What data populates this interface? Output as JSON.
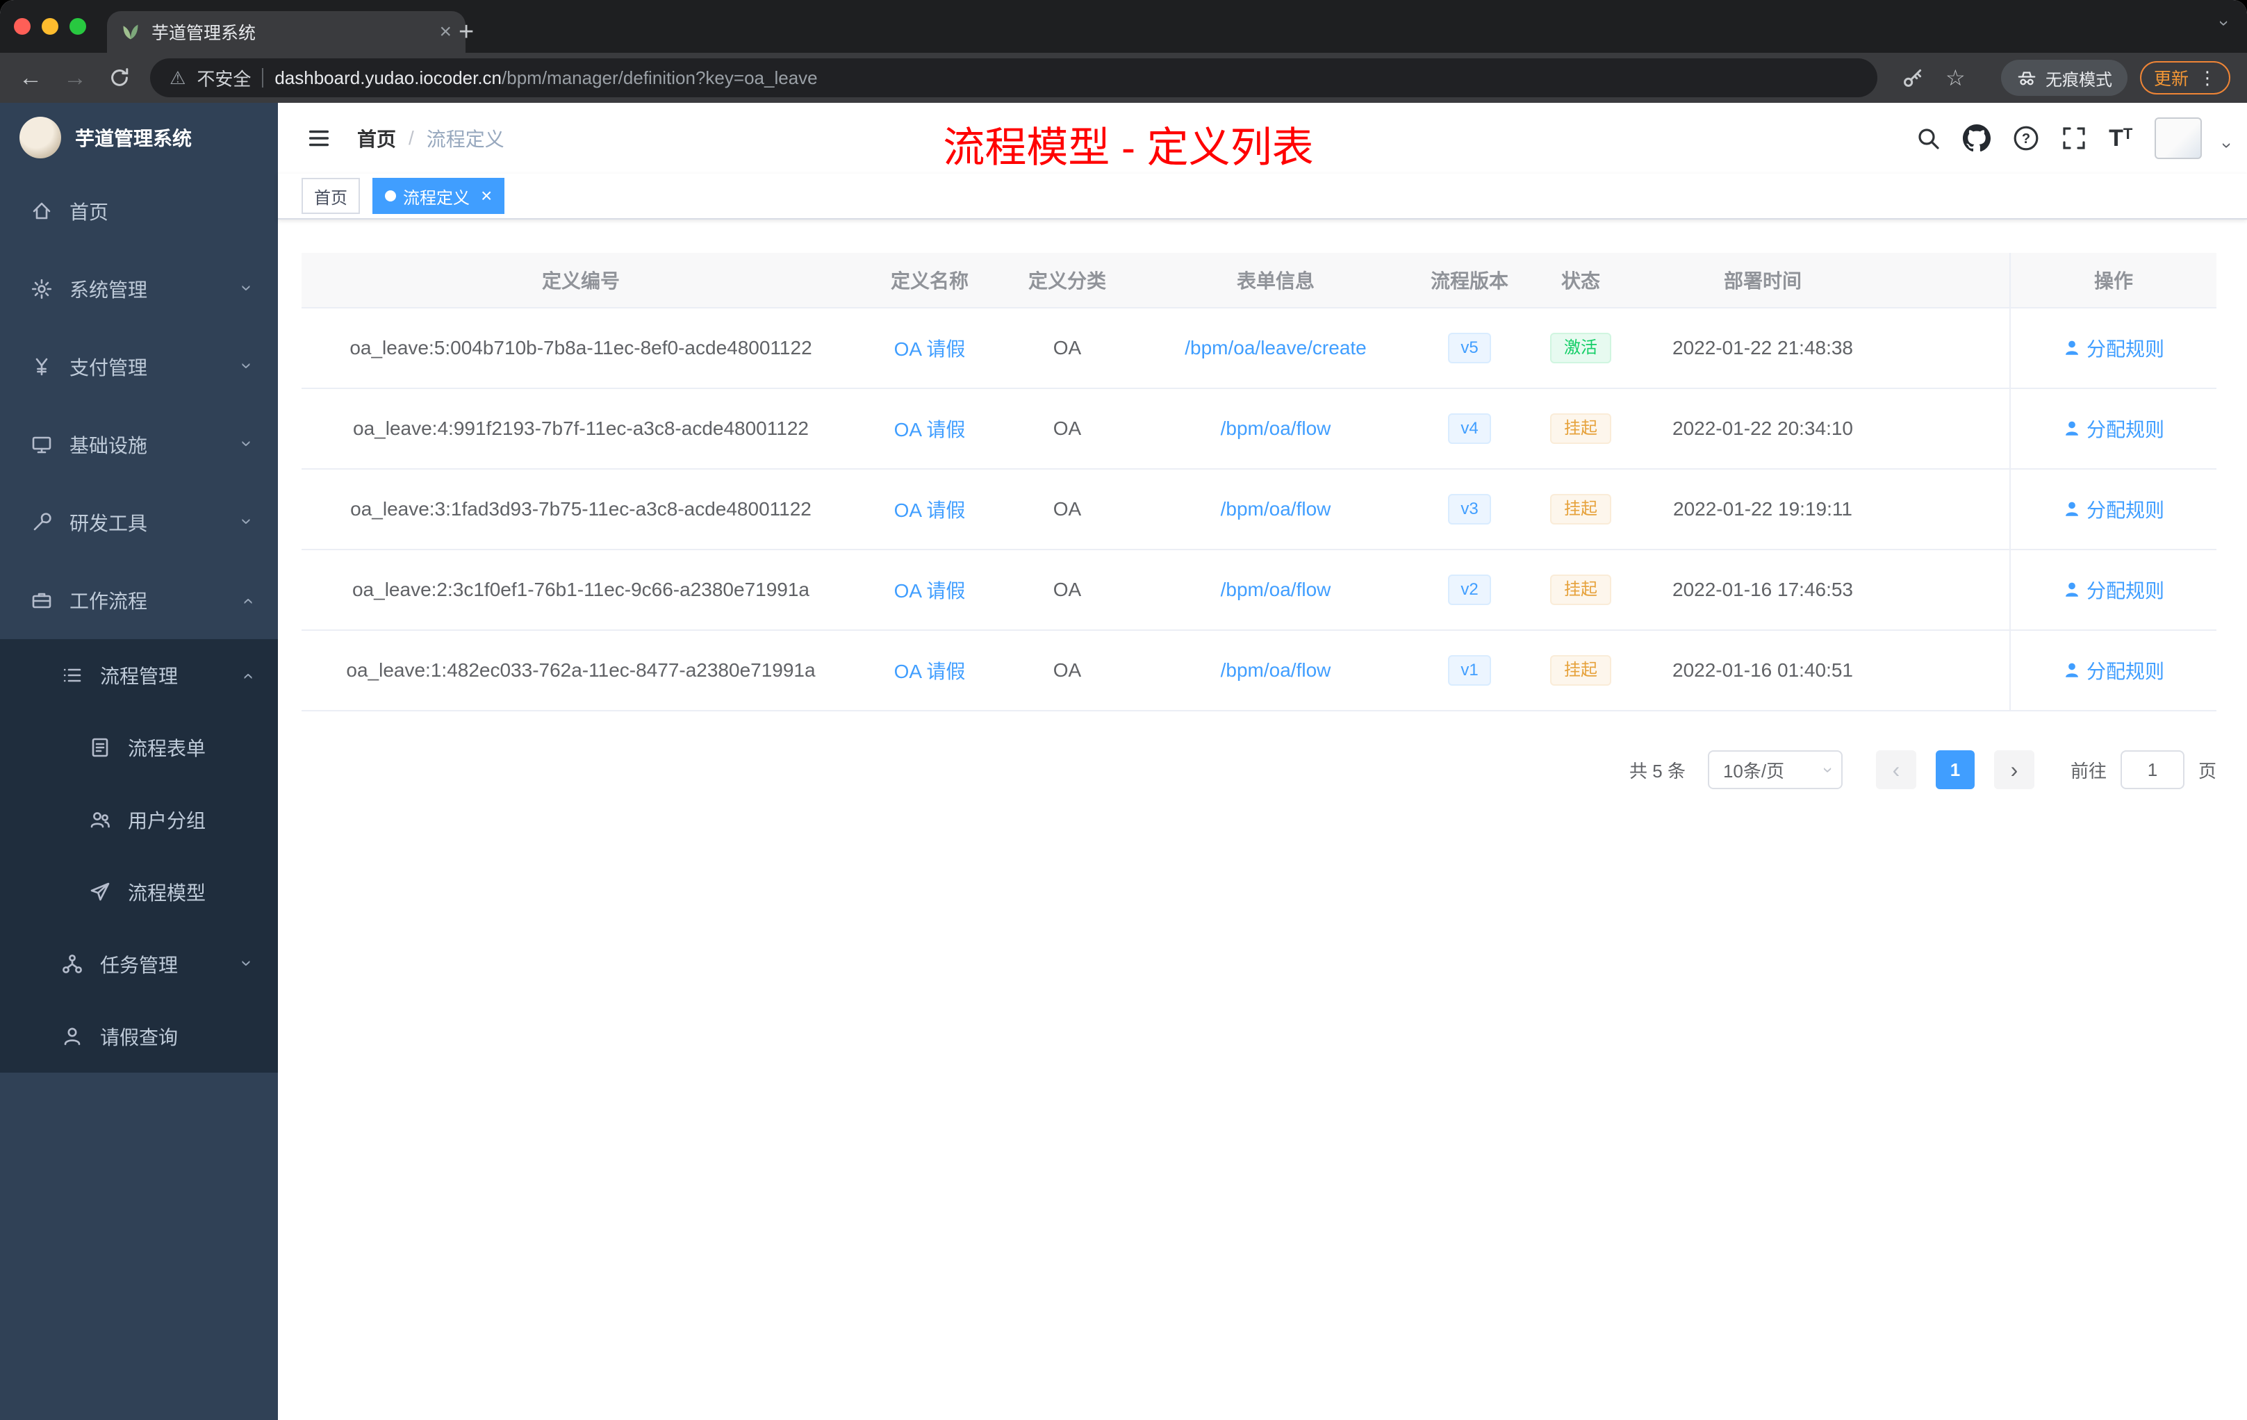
{
  "browser": {
    "tab_title": "芋道管理系统",
    "security_label": "不安全",
    "url_domain": "dashboard.yudao.iocoder.cn",
    "url_path": "/bpm/manager/definition?key=oa_leave",
    "incognito_label": "无痕模式",
    "update_label": "更新"
  },
  "sidebar": {
    "brand": "芋道管理系统",
    "items": [
      {
        "label": "首页"
      },
      {
        "label": "系统管理"
      },
      {
        "label": "支付管理"
      },
      {
        "label": "基础设施"
      },
      {
        "label": "研发工具"
      },
      {
        "label": "工作流程"
      },
      {
        "label": "流程管理"
      },
      {
        "label": "流程表单"
      },
      {
        "label": "用户分组"
      },
      {
        "label": "流程模型"
      },
      {
        "label": "任务管理"
      },
      {
        "label": "请假查询"
      }
    ]
  },
  "header": {
    "breadcrumb_home": "首页",
    "breadcrumb_sep": "/",
    "breadcrumb_current": "流程定义",
    "annotation": "流程模型 - 定义列表"
  },
  "tags": {
    "home": "首页",
    "active": "流程定义"
  },
  "table": {
    "columns": [
      "定义编号",
      "定义名称",
      "定义分类",
      "表单信息",
      "流程版本",
      "状态",
      "部署时间",
      "操作"
    ],
    "rows": [
      {
        "id": "oa_leave:5:004b710b-7b8a-11ec-8ef0-acde48001122",
        "name": "OA 请假",
        "category": "OA",
        "form": "/bpm/oa/leave/create",
        "version": "v5",
        "status": "激活",
        "deployed_at": "2022-01-22 21:48:38",
        "action": "分配规则"
      },
      {
        "id": "oa_leave:4:991f2193-7b7f-11ec-a3c8-acde48001122",
        "name": "OA 请假",
        "category": "OA",
        "form": "/bpm/oa/flow",
        "version": "v4",
        "status": "挂起",
        "deployed_at": "2022-01-22 20:34:10",
        "action": "分配规则"
      },
      {
        "id": "oa_leave:3:1fad3d93-7b75-11ec-a3c8-acde48001122",
        "name": "OA 请假",
        "category": "OA",
        "form": "/bpm/oa/flow",
        "version": "v3",
        "status": "挂起",
        "deployed_at": "2022-01-22 19:19:11",
        "action": "分配规则"
      },
      {
        "id": "oa_leave:2:3c1f0ef1-76b1-11ec-9c66-a2380e71991a",
        "name": "OA 请假",
        "category": "OA",
        "form": "/bpm/oa/flow",
        "version": "v2",
        "status": "挂起",
        "deployed_at": "2022-01-16 17:46:53",
        "action": "分配规则"
      },
      {
        "id": "oa_leave:1:482ec033-762a-11ec-8477-a2380e71991a",
        "name": "OA 请假",
        "category": "OA",
        "form": "/bpm/oa/flow",
        "version": "v1",
        "status": "挂起",
        "deployed_at": "2022-01-16 01:40:51",
        "action": "分配规则"
      }
    ]
  },
  "pagination": {
    "total": "共 5 条",
    "page_size": "10条/页",
    "current_page": "1",
    "goto_label": "前往",
    "goto_value": "1",
    "unit_label": "页"
  }
}
